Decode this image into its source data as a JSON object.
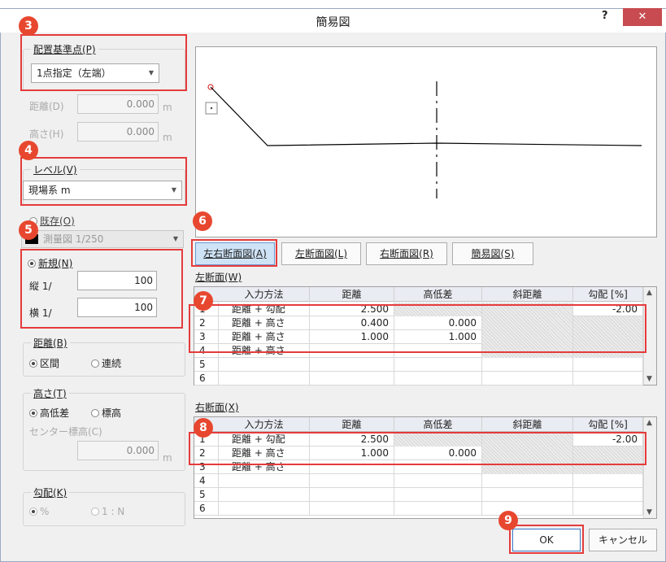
{
  "window": {
    "title": "簡易図",
    "help": "?",
    "close": "✕"
  },
  "badges": {
    "b3": "3",
    "b4": "4",
    "b5": "5",
    "b6": "6",
    "b7": "7",
    "b8": "8",
    "b9": "9"
  },
  "base_point": {
    "legend": "配置基準点(P)",
    "value": "1点指定（左端）"
  },
  "distance_field": {
    "label": "距離(D)",
    "value": "0.000",
    "unit": "m"
  },
  "height_field": {
    "label": "高さ(H)",
    "value": "0.000",
    "unit": "m"
  },
  "level": {
    "legend": "レベル(V)",
    "value": "現場系 m"
  },
  "existing": {
    "label": "既存(O)",
    "value": "測量図 1/250"
  },
  "new": {
    "label": "新規(N)",
    "vertical_label": "縦 1/",
    "vertical_value": "100",
    "horizontal_label": "横 1/",
    "horizontal_value": "100"
  },
  "distance_mode": {
    "legend": "距離(B)",
    "opt1": "区間",
    "opt2": "連続"
  },
  "height_mode": {
    "legend": "高さ(T)",
    "opt1": "高低差",
    "opt2": "標高",
    "center_label": "センター標高(C)",
    "center_value": "0.000",
    "unit": "m"
  },
  "slope_mode": {
    "legend": "勾配(K)",
    "opt1": "%",
    "opt2": "1 : N"
  },
  "tabs": {
    "both": "左右断面図(A)",
    "left": "左断面図(L)",
    "right": "右断面図(R)",
    "simple": "簡易図(S)"
  },
  "left_section": {
    "title": "左断面(W)",
    "headers": [
      "入力方法",
      "距離",
      "高低差",
      "斜距離",
      "勾配 [%]"
    ],
    "rows": [
      {
        "no": "1",
        "method": "距離 + 勾配",
        "dist": "2.500",
        "diff": "",
        "slant": "",
        "grade": "-2.00"
      },
      {
        "no": "2",
        "method": "距離 + 高さ",
        "dist": "0.400",
        "diff": "0.000",
        "slant": "",
        "grade": ""
      },
      {
        "no": "3",
        "method": "距離 + 高さ",
        "dist": "1.000",
        "diff": "1.000",
        "slant": "",
        "grade": ""
      },
      {
        "no": "4",
        "method": "距離 + 高さ",
        "dist": "",
        "diff": "",
        "slant": "",
        "grade": ""
      },
      {
        "no": "5",
        "method": "",
        "dist": "",
        "diff": "",
        "slant": "",
        "grade": ""
      },
      {
        "no": "6",
        "method": "",
        "dist": "",
        "diff": "",
        "slant": "",
        "grade": ""
      }
    ]
  },
  "right_section": {
    "title": "右断面(X)",
    "headers": [
      "入力方法",
      "距離",
      "高低差",
      "斜距離",
      "勾配 [%]"
    ],
    "rows": [
      {
        "no": "1",
        "method": "距離 + 勾配",
        "dist": "2.500",
        "diff": "",
        "slant": "",
        "grade": "-2.00"
      },
      {
        "no": "2",
        "method": "距離 + 高さ",
        "dist": "1.000",
        "diff": "0.000",
        "slant": "",
        "grade": ""
      },
      {
        "no": "3",
        "method": "距離 + 高さ",
        "dist": "",
        "diff": "",
        "slant": "",
        "grade": ""
      },
      {
        "no": "4",
        "method": "",
        "dist": "",
        "diff": "",
        "slant": "",
        "grade": ""
      },
      {
        "no": "5",
        "method": "",
        "dist": "",
        "diff": "",
        "slant": "",
        "grade": ""
      },
      {
        "no": "6",
        "method": "",
        "dist": "",
        "diff": "",
        "slant": "",
        "grade": ""
      }
    ]
  },
  "buttons": {
    "ok": "OK",
    "cancel": "キャンセル"
  },
  "colors": {
    "highlight": "#e53b3b",
    "badge": "#e8472f"
  }
}
